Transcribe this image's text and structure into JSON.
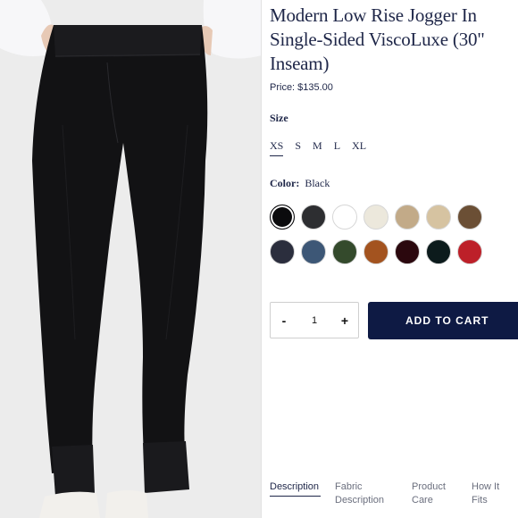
{
  "product": {
    "title": "Modern Low Rise Jogger In Single-Sided ViscoLuxe (30\" Inseam)",
    "price_label": "Price:",
    "price": "$135.00"
  },
  "size": {
    "heading": "Size",
    "options": [
      "XS",
      "S",
      "M",
      "L",
      "XL"
    ],
    "selected": "XS"
  },
  "color": {
    "label": "Color:",
    "selected_name": "Black",
    "swatches": [
      {
        "hex": "#0b0b0d",
        "selected": true
      },
      {
        "hex": "#2d2e31"
      },
      {
        "hex": "#ffffff"
      },
      {
        "hex": "#ece8dc"
      },
      {
        "hex": "#c2aa88"
      },
      {
        "hex": "#d6c3a1"
      },
      {
        "hex": "#6b4f35"
      },
      {
        "hex": "#2b2e3d"
      },
      {
        "hex": "#3d5776"
      },
      {
        "hex": "#344a2c"
      },
      {
        "hex": "#a3531f"
      },
      {
        "hex": "#2b080e"
      },
      {
        "hex": "#0c1b1c"
      },
      {
        "hex": "#bd2029"
      }
    ]
  },
  "quantity": {
    "minus": "-",
    "value": "1",
    "plus": "+"
  },
  "cart": {
    "label": "ADD TO CART"
  },
  "tabs": [
    {
      "line1": "Description",
      "line2": ""
    },
    {
      "line1": "Fabric",
      "line2": "Description"
    },
    {
      "line1": "Product",
      "line2": "Care"
    },
    {
      "line1": "How It",
      "line2": "Fits"
    }
  ],
  "colors": {
    "brand_navy": "#0e1a44",
    "text_navy": "#1e2648"
  }
}
